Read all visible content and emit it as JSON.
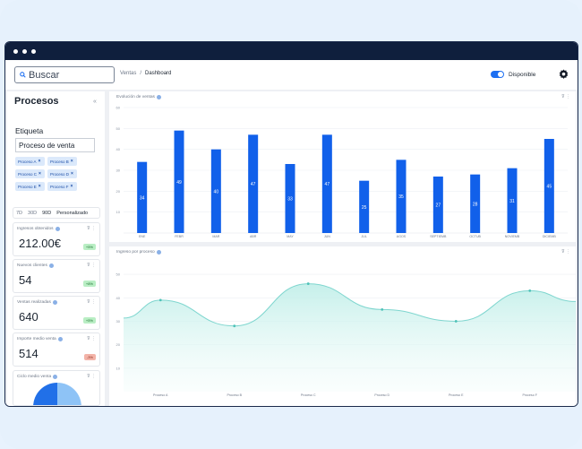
{
  "topbar": {
    "search_placeholder": "Buscar",
    "breadcrumb": [
      "Ventas",
      "/",
      "Dashboard"
    ],
    "availability_label": "Disponible"
  },
  "sidebar": {
    "title": "Procesos",
    "tag_label": "Etiqueta",
    "tag_value": "Proceso de venta",
    "chips": [
      "Proceso A",
      "Proceso B",
      "Proceso C",
      "Proceso D",
      "Proceso E",
      "Proceso F"
    ],
    "ranges": [
      "7D",
      "30D",
      "90D",
      "Personalizado"
    ],
    "kpis": [
      {
        "title": "Ingresos obtenidos",
        "value": "212.00€",
        "badge": "+5%",
        "tone": "green"
      },
      {
        "title": "Nuevos clientes",
        "value": "54",
        "badge": "+8%",
        "tone": "green"
      },
      {
        "title": "Ventas realizadas",
        "value": "640",
        "badge": "+5%",
        "tone": "green"
      },
      {
        "title": "Importe medio venta",
        "value": "514",
        "badge": "-3%",
        "tone": "red"
      },
      {
        "title": "Ciclo medio venta",
        "value": "",
        "badge": "",
        "tone": ""
      }
    ]
  },
  "chart_data": [
    {
      "type": "bar",
      "title": "Evolución de ventas",
      "categories": [
        "ENE",
        "FEBR",
        "MAR",
        "ABR",
        "MAY",
        "JUN",
        "JUL",
        "AGOS",
        "SEPTIEMB",
        "OCTUB",
        "NOVIEMB",
        "DICIEMB"
      ],
      "values": [
        34,
        49,
        40,
        47,
        33,
        47,
        25,
        35,
        27,
        28,
        31,
        45
      ],
      "yticks": [
        10,
        20,
        30,
        40,
        50,
        60
      ],
      "ylim": [
        0,
        60
      ],
      "grid": true,
      "color": "#1160ea"
    },
    {
      "type": "area",
      "title": "Ingreso por proceso",
      "categories": [
        "Proceso A",
        "Proceso B",
        "Proceso C",
        "Proceso D",
        "Proceso E",
        "Proceso F"
      ],
      "values": [
        39,
        28,
        46,
        35,
        30,
        43
      ],
      "yticks": [
        10,
        20,
        30,
        40,
        50
      ],
      "ylim": [
        0,
        55
      ],
      "grid": true,
      "color": "#7fd6cf"
    }
  ],
  "colors": {
    "accent": "#1d6ff2",
    "navy": "#0f1f3d"
  }
}
